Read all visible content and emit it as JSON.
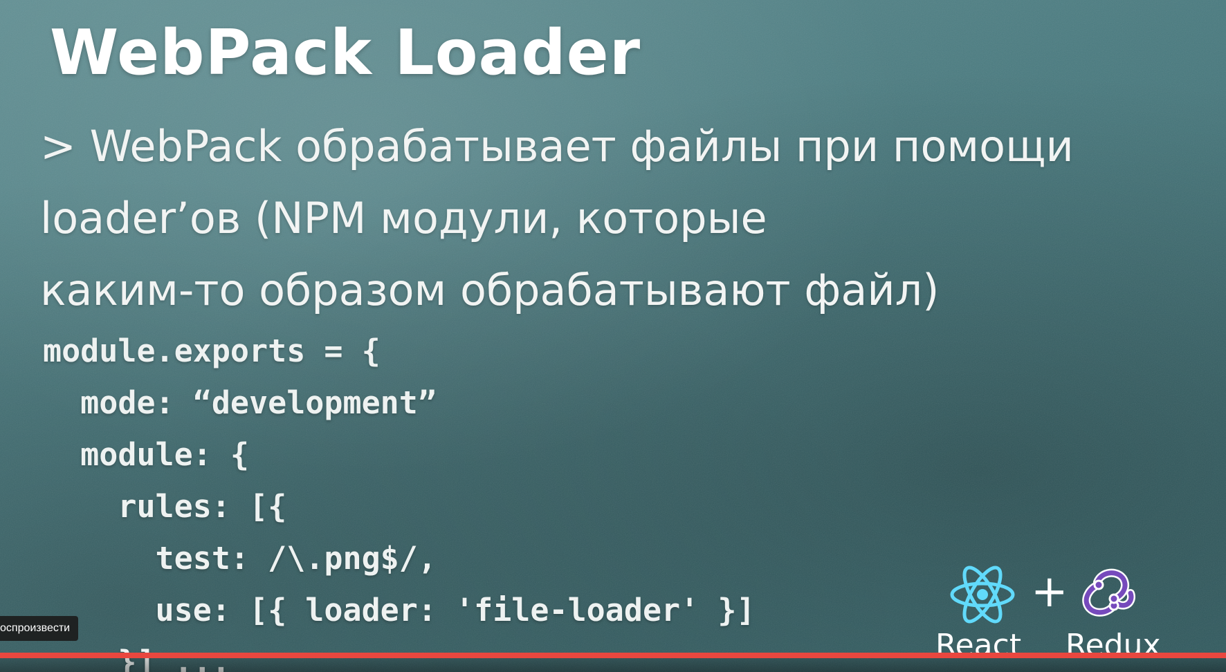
{
  "slide": {
    "title": "WebPack Loader",
    "bullet_lines": [
      "> WebPack обрабатывает файлы при помощи",
      "loader’ов (NPM модули, которые",
      "каким-то образом обрабатывают файл)"
    ],
    "code_lines": [
      "module.exports = {",
      "  mode: “development”",
      "  module: {",
      "    rules: [{",
      "      test: /\\.png$/,",
      "      use: [{ loader: 'file-loader' }]",
      "    }] ..."
    ],
    "logos": {
      "react_label": "React",
      "plus": "+",
      "redux_label": "Redux",
      "react_icon": "react-atom-icon",
      "redux_icon": "redux-icon",
      "react_color": "#61dafb",
      "redux_color": "#764abc"
    }
  },
  "player": {
    "tooltip_text": "оспроизвести",
    "progress_fraction": 1.0,
    "progress_color": "#e9473f"
  }
}
